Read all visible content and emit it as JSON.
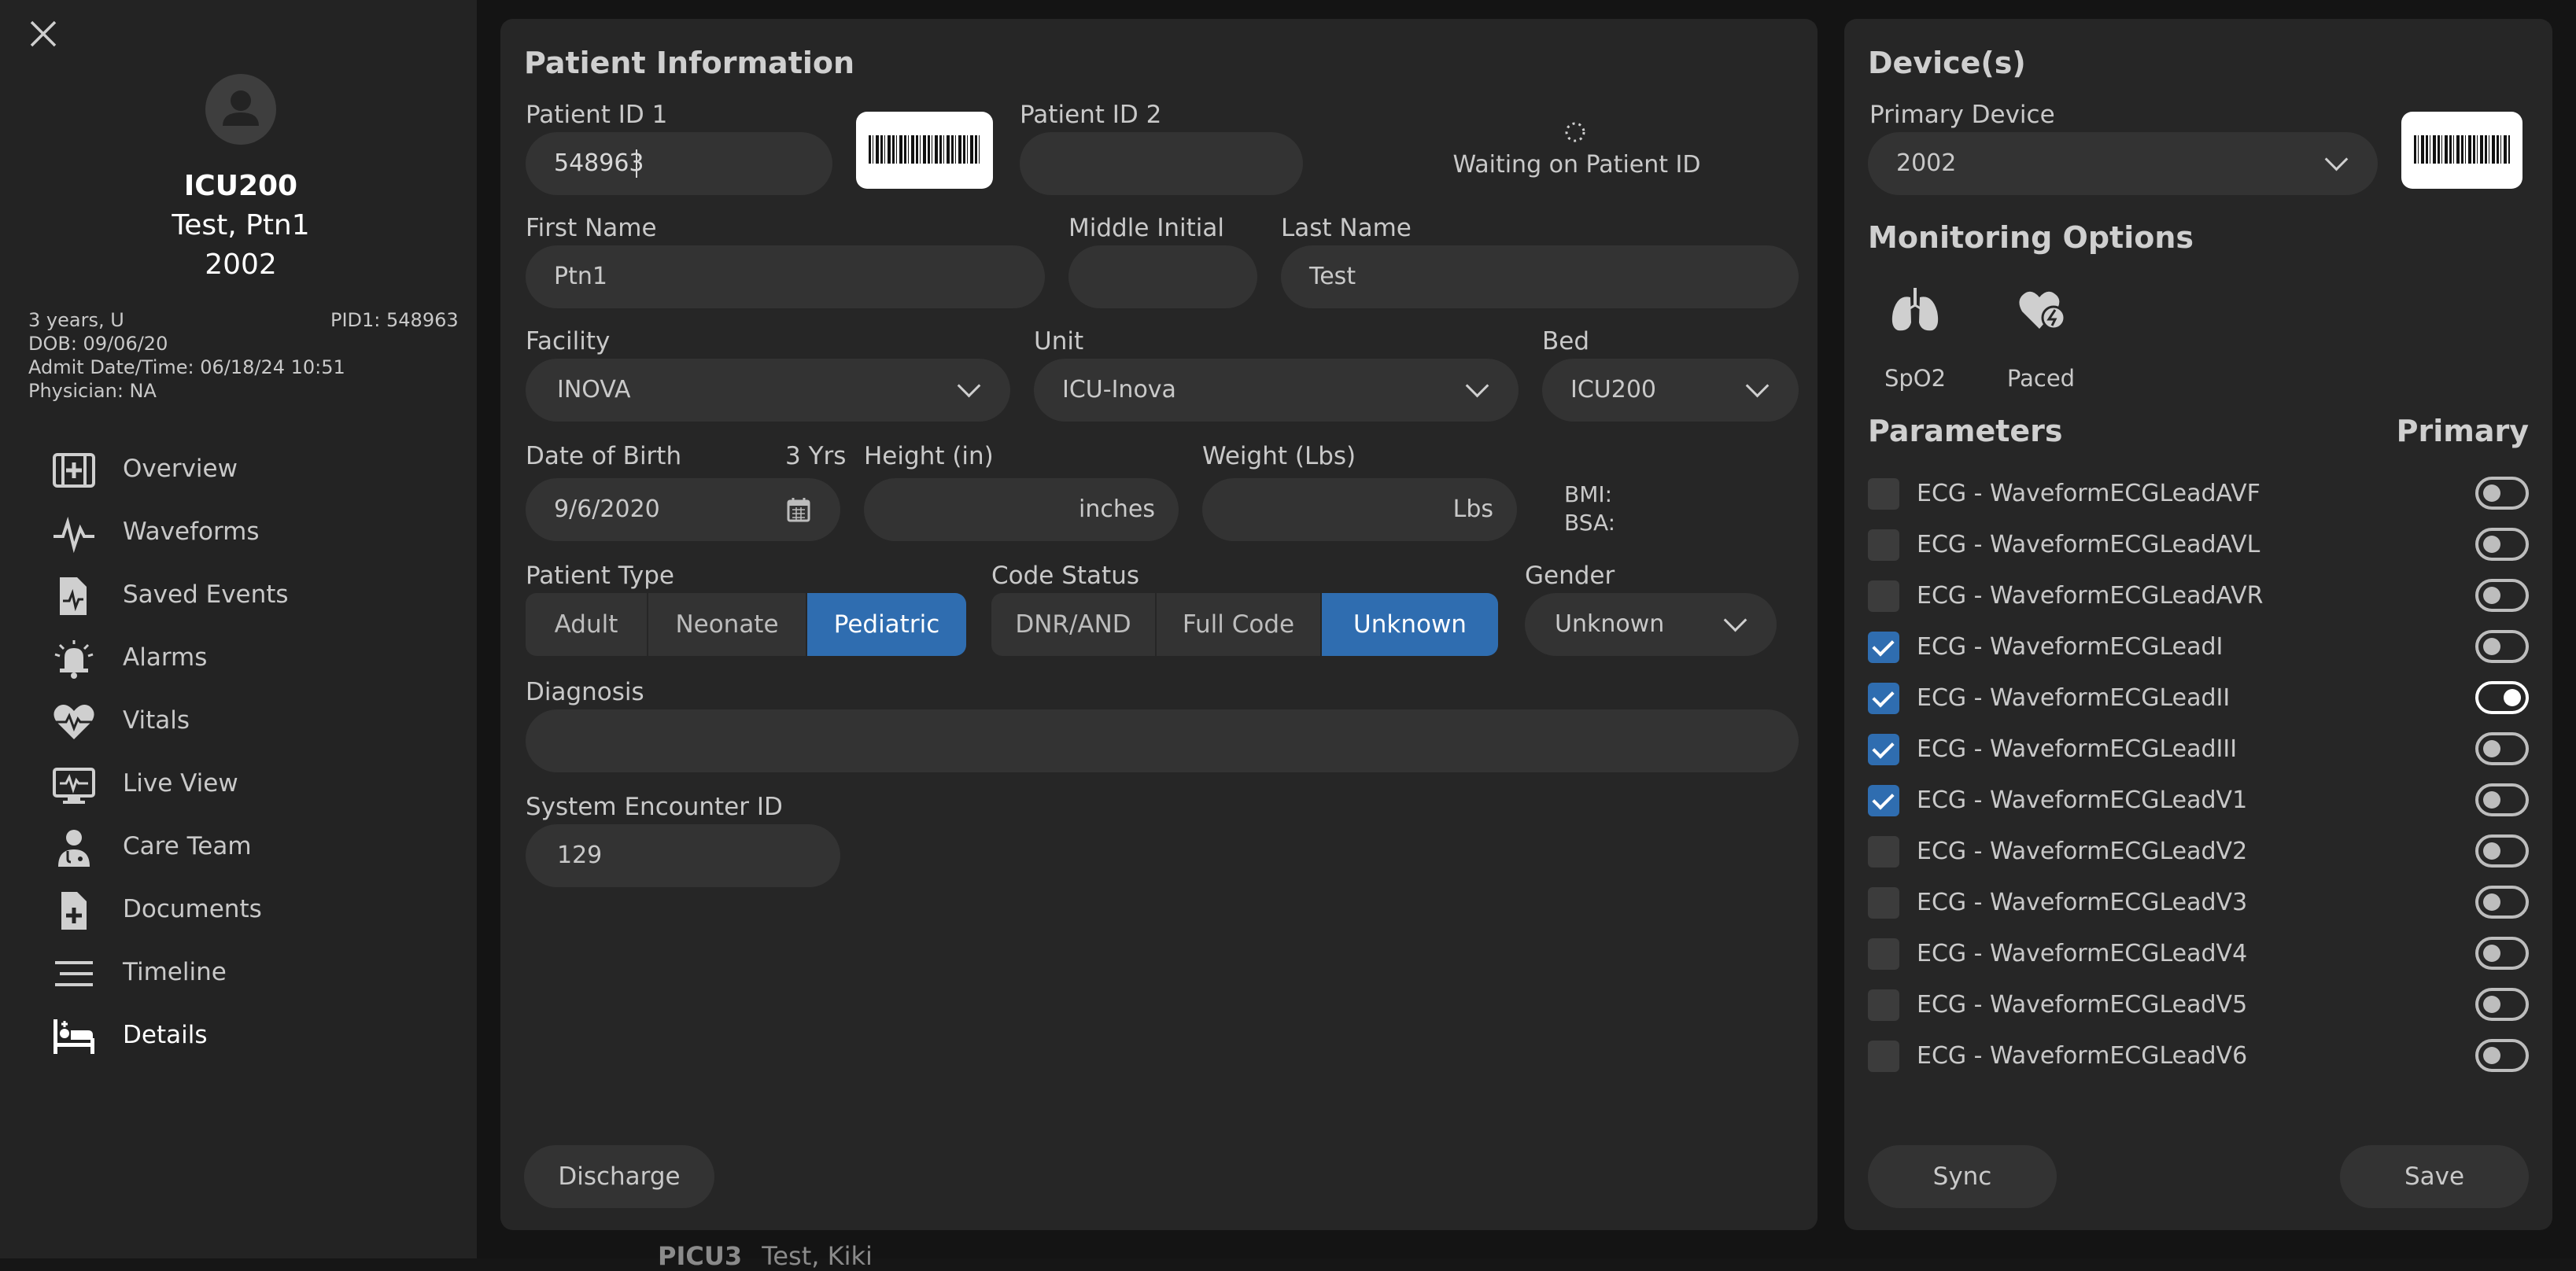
{
  "patient_summary": {
    "bed": "ICU200",
    "name": "Test, Ptn1",
    "device": "2002",
    "age_gender": "3 years, U",
    "pid": "PID1: 548963",
    "dob": "DOB: 09/06/20",
    "admit": "Admit Date/Time: 06/18/24 10:51",
    "physician": "Physician: NA"
  },
  "nav": {
    "items": [
      {
        "label": "Overview",
        "icon": "medical-case-icon"
      },
      {
        "label": "Waveforms",
        "icon": "waveform-icon"
      },
      {
        "label": "Saved Events",
        "icon": "saved-events-icon"
      },
      {
        "label": "Alarms",
        "icon": "alarm-bell-icon"
      },
      {
        "label": "Vitals",
        "icon": "heart-pulse-icon"
      },
      {
        "label": "Live View",
        "icon": "monitor-icon"
      },
      {
        "label": "Care Team",
        "icon": "doctor-icon"
      },
      {
        "label": "Documents",
        "icon": "document-add-icon"
      },
      {
        "label": "Timeline",
        "icon": "timeline-icon"
      },
      {
        "label": "Details",
        "icon": "bed-icon"
      }
    ],
    "active": "Details"
  },
  "patient_info": {
    "title": "Patient Information",
    "pid1_label": "Patient ID 1",
    "pid1_value": "548963",
    "pid2_label": "Patient ID 2",
    "pid2_value": "",
    "waiting_text": "Waiting on Patient ID",
    "first_name_label": "First Name",
    "first_name_value": "Ptn1",
    "middle_label": "Middle Initial",
    "middle_value": "",
    "last_name_label": "Last Name",
    "last_name_value": "Test",
    "facility_label": "Facility",
    "facility_value": "INOVA",
    "unit_label": "Unit",
    "unit_value": "ICU-Inova",
    "bed_label": "Bed",
    "bed_value": "ICU200",
    "dob_label": "Date of Birth",
    "age_text": "3 Yrs",
    "dob_value": "9/6/2020",
    "height_label": "Height (in)",
    "height_unit": "inches",
    "weight_label": "Weight (Lbs)",
    "weight_unit": "Lbs",
    "bmi_label": "BMI:",
    "bsa_label": "BSA:",
    "patient_type_label": "Patient Type",
    "patient_types": [
      "Adult",
      "Neonate",
      "Pediatric"
    ],
    "patient_type_selected": "Pediatric",
    "code_status_label": "Code Status",
    "code_statuses": [
      "DNR/AND",
      "Full Code",
      "Unknown"
    ],
    "code_status_selected": "Unknown",
    "gender_label": "Gender",
    "gender_value": "Unknown",
    "diagnosis_label": "Diagnosis",
    "diagnosis_value": "",
    "encounter_label": "System Encounter ID",
    "encounter_value": "129",
    "discharge_label": "Discharge"
  },
  "devices": {
    "title": "Device(s)",
    "primary_label": "Primary Device",
    "primary_value": "2002",
    "monitoring_title": "Monitoring Options",
    "options": [
      {
        "label": "SpO2",
        "icon": "lungs-icon"
      },
      {
        "label": "Paced",
        "icon": "paced-heart-icon"
      }
    ],
    "parameters_title": "Parameters",
    "primary_col": "Primary",
    "parameters": [
      {
        "label": "ECG - WaveformECGLeadAVF",
        "checked": false,
        "primary": false
      },
      {
        "label": "ECG - WaveformECGLeadAVL",
        "checked": false,
        "primary": false
      },
      {
        "label": "ECG - WaveformECGLeadAVR",
        "checked": false,
        "primary": false
      },
      {
        "label": "ECG - WaveformECGLeadI",
        "checked": true,
        "primary": false
      },
      {
        "label": "ECG - WaveformECGLeadII",
        "checked": true,
        "primary": true
      },
      {
        "label": "ECG - WaveformECGLeadIII",
        "checked": true,
        "primary": false
      },
      {
        "label": "ECG - WaveformECGLeadV1",
        "checked": true,
        "primary": false
      },
      {
        "label": "ECG - WaveformECGLeadV2",
        "checked": false,
        "primary": false
      },
      {
        "label": "ECG - WaveformECGLeadV3",
        "checked": false,
        "primary": false
      },
      {
        "label": "ECG - WaveformECGLeadV4",
        "checked": false,
        "primary": false
      },
      {
        "label": "ECG - WaveformECGLeadV5",
        "checked": false,
        "primary": false
      },
      {
        "label": "ECG - WaveformECGLeadV6",
        "checked": false,
        "primary": false
      }
    ],
    "sync_label": "Sync",
    "save_label": "Save"
  },
  "background_peek": {
    "bed_text": "PICU3",
    "name_text": "Test, Kiki"
  },
  "colors": {
    "accent": "#2f6db0",
    "panel": "#262626",
    "field": "#333333",
    "sidebar": "#232323"
  }
}
